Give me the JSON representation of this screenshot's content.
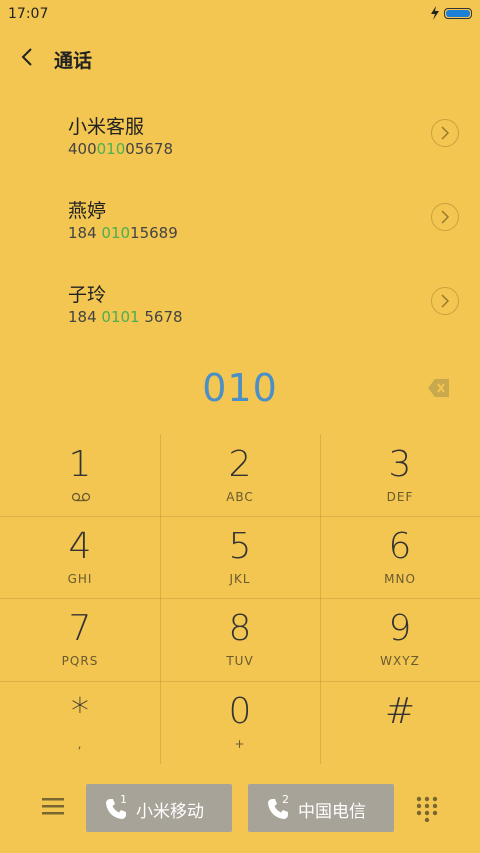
{
  "status": {
    "time": "17:07"
  },
  "header": {
    "title": "通话"
  },
  "contacts": [
    {
      "name": "小米客服",
      "num_pre": "400",
      "num_hl": "010",
      "num_post": "05678"
    },
    {
      "name": "燕婷",
      "num_pre": "184 ",
      "num_hl": "010",
      "num_post": "15689"
    },
    {
      "name": "子玲",
      "num_pre": "184 ",
      "num_hl": "0101",
      "num_post": " 5678"
    }
  ],
  "dial": {
    "input": "010"
  },
  "keypad": [
    {
      "digit": "1",
      "letters": ""
    },
    {
      "digit": "2",
      "letters": "ABC"
    },
    {
      "digit": "3",
      "letters": "DEF"
    },
    {
      "digit": "4",
      "letters": "GHI"
    },
    {
      "digit": "5",
      "letters": "JKL"
    },
    {
      "digit": "6",
      "letters": "MNO"
    },
    {
      "digit": "7",
      "letters": "PQRS"
    },
    {
      "digit": "8",
      "letters": "TUV"
    },
    {
      "digit": "9",
      "letters": "WXYZ"
    },
    {
      "digit": "*",
      "letters": ","
    },
    {
      "digit": "0",
      "letters": "+"
    },
    {
      "digit": "#",
      "letters": ""
    }
  ],
  "sims": [
    {
      "num": "1",
      "label": "小米移动"
    },
    {
      "num": "2",
      "label": "中国电信"
    }
  ],
  "colors": {
    "background": "#f2c650",
    "accent": "#4a8fc8",
    "highlight": "#4caf50",
    "sim_button": "#a8a398"
  }
}
